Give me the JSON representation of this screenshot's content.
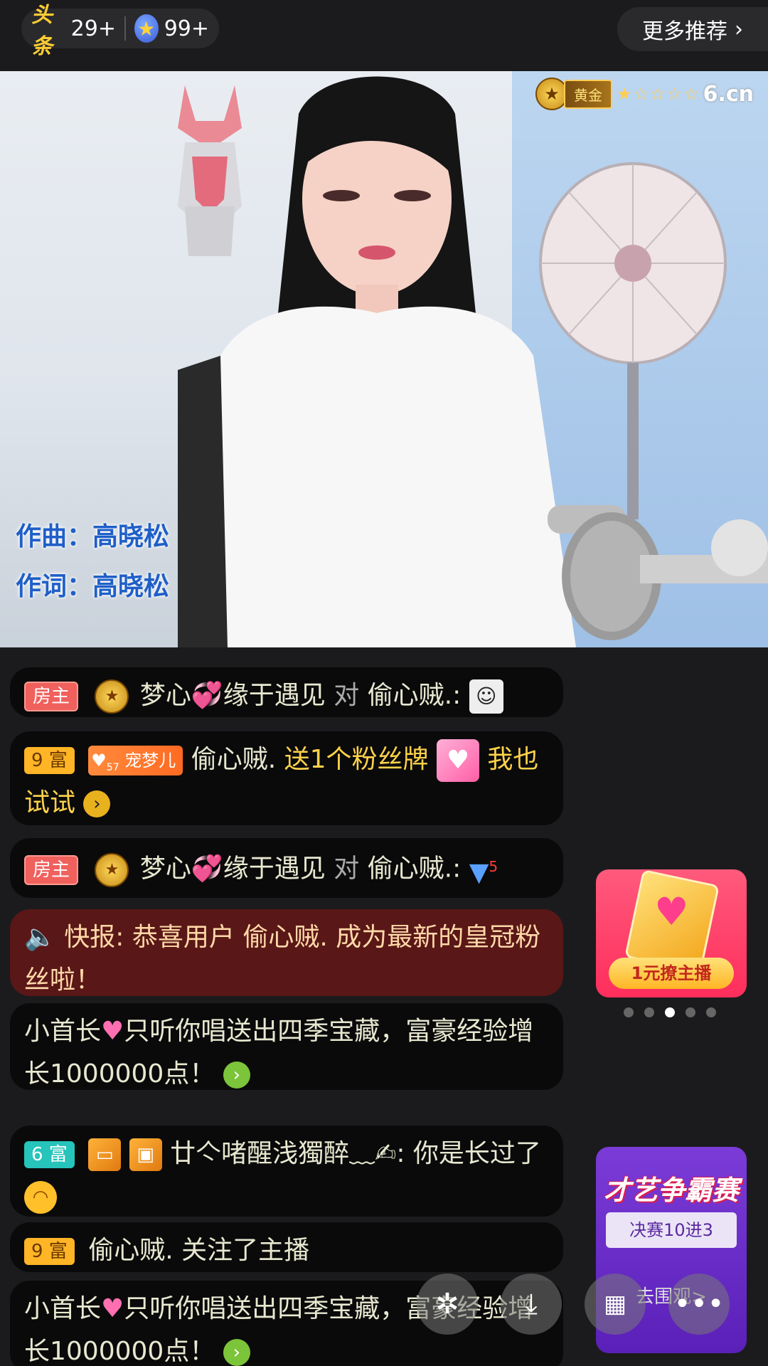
{
  "topbar": {
    "headline_logo": "头条",
    "headline_count": "29+",
    "star_count": "99+",
    "more_label": "更多推荐"
  },
  "video": {
    "lyric_composer": "作曲：高晓松",
    "lyric_writer": "作词：高晓松",
    "level_label": "黄金",
    "level_stars": "★☆☆☆☆",
    "watermark": "6.cn"
  },
  "chat": [
    {
      "tag": "房主",
      "name": "梦心💞缘于遇见",
      "verb": "对",
      "target": "偷心贼.:"
    },
    {
      "tag": "9 富",
      "pet": "宠梦儿",
      "pet_level": "57",
      "name": "偷心贼.",
      "gift_text": "送1个粉丝牌",
      "extra": "我也试试"
    },
    {
      "tag": "房主",
      "name": "梦心💞缘于遇见",
      "verb": "对",
      "target": "偷心贼.:"
    },
    {
      "prefix": "快报:",
      "text": "恭喜用户 偷心贼. 成为最新的皇冠粉丝啦！"
    },
    {
      "name": "小首长",
      "text": "只听你唱送出四季宝藏，富豪经验增长1000000点！"
    },
    {
      "tag": "6 富",
      "name": "廿亽啫醒浅獨醉﹏✍:",
      "text": "你是长过了"
    },
    {
      "tag": "9 富",
      "name": "偷心贼.",
      "text": "关注了主播"
    },
    {
      "name": "小首长",
      "text": "只听你唱送出四季宝藏，富豪经验增长1000000点！"
    }
  ],
  "promo": {
    "label": "1元撩主播"
  },
  "contest": {
    "title": "才艺争霸赛",
    "subtitle": "决赛10进3",
    "action": "去围观>"
  },
  "colors": {
    "background": "#1b1b1d",
    "host_tag": "#f0605d",
    "rich_tag": "#ffb526",
    "gold_text": "#ffd24a"
  }
}
